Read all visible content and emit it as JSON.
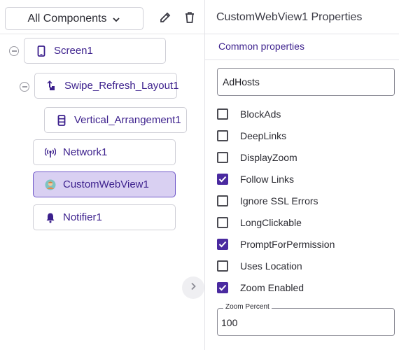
{
  "left_panel": {
    "dropdown_label": "All Components",
    "tree": [
      {
        "label": "Screen1",
        "icon": "phone-icon",
        "selected": false
      },
      {
        "label": "Swipe_Refresh_Layout1",
        "icon": "swipe-gesture-icon",
        "selected": false
      },
      {
        "label": "Vertical_Arrangement1",
        "icon": "vertical-arrangement-icon",
        "selected": false
      },
      {
        "label": "Network1",
        "icon": "network-antenna-icon",
        "selected": false
      },
      {
        "label": "CustomWebView1",
        "icon": "webview-avatar-icon",
        "selected": true
      },
      {
        "label": "Notifier1",
        "icon": "bell-icon",
        "selected": false
      }
    ]
  },
  "right_panel": {
    "title": "CustomWebView1 Properties",
    "section_title": "Common properties",
    "textbox_value": "AdHosts",
    "checkboxes": [
      {
        "label": "BlockAds",
        "checked": false
      },
      {
        "label": "DeepLinks",
        "checked": false
      },
      {
        "label": "DisplayZoom",
        "checked": false
      },
      {
        "label": "Follow Links",
        "checked": true
      },
      {
        "label": "Ignore SSL Errors",
        "checked": false
      },
      {
        "label": "LongClickable",
        "checked": false
      },
      {
        "label": "PromptForPermission",
        "checked": true
      },
      {
        "label": "Uses Location",
        "checked": false
      },
      {
        "label": "Zoom Enabled",
        "checked": true
      }
    ],
    "zoom_percent": {
      "label": "Zoom Percent",
      "value": "100"
    }
  },
  "colors": {
    "accent": "#4a2aa0",
    "selected_bg": "#d9d0f2",
    "label_text": "#3b1f8c"
  }
}
